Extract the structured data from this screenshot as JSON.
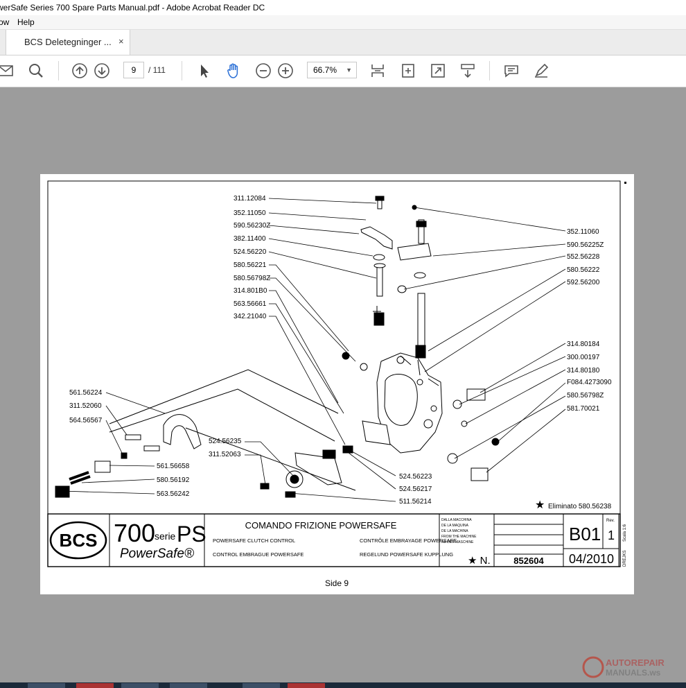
{
  "window": {
    "title": "werSafe Series 700 Spare Parts Manual.pdf - Adobe Acrobat Reader DC"
  },
  "menu": {
    "items": [
      "ow",
      "Help"
    ]
  },
  "tab": {
    "label": "BCS Deletegninger ...",
    "close": "×"
  },
  "toolbar": {
    "page_current": "9",
    "page_total": "/ 111",
    "zoom": "66.7%",
    "icons": [
      "mail-icon",
      "search-icon",
      "prev-page-icon",
      "next-page-icon",
      "select-tool-icon",
      "hand-tool-icon",
      "zoom-out-icon",
      "zoom-in-icon",
      "fit-page-icon",
      "rotate-icon",
      "fullscreen-icon",
      "scroll-mode-icon",
      "comment-icon",
      "highlight-icon"
    ]
  },
  "document": {
    "page_footer": "Side 9",
    "title_block": {
      "logo": "BCS",
      "series": "700",
      "series_small": "serie",
      "series_suffix": "PS",
      "brand": "PowerSafe®",
      "title": "COMANDO FRIZIONE POWERSAFE",
      "sub_en": "POWERSAFE CLUTCH CONTROL",
      "sub_fr": "CONTRÔLE EMBRAYAGE POWERSAFE",
      "sub_es": "CONTROL EMBRAGUE POWERSAFE",
      "sub_de": "REGELUND POWERSAFE KUPPLUNG",
      "from_machine": [
        "DALLA MACCHINA",
        "DE LA MAQUINA",
        "DE LA MACHINA",
        "FROM THE MACHINE",
        "AB DER MASCHINE"
      ],
      "star_n": "★ N.",
      "drawing_no": "852604",
      "code": "B01",
      "rev_label": "Rev.",
      "rev": "1",
      "date": "04/2010",
      "scale": "Scala 1:6",
      "drawn": "DREJKS",
      "eliminated": "Eliminato 580.56238"
    },
    "labels_left_top": [
      "311.12084",
      "352.11050",
      "590.56230Z",
      "382.11400",
      "524.56220",
      "580.56221",
      "580.56798Z",
      "314.801B0",
      "563.56661",
      "342.21040"
    ],
    "labels_right": [
      "352.11060",
      "590.56225Z",
      "552.56228",
      "580.56222",
      "592.56200",
      "314.80184",
      "300.00197",
      "314.80180",
      "F084.4273090",
      "580.56798Z",
      "581.70021"
    ],
    "labels_left_bottom": [
      "561.56224",
      "311.52060",
      "564.56567",
      "561.56658",
      "580.56192",
      "563.56242"
    ],
    "labels_center": [
      "524.56235",
      "311.52063",
      "524.56223",
      "524.56217",
      "511.56214"
    ]
  },
  "watermark": {
    "line1": "AUTOREPAIR",
    "line2": "MANUALS.ws"
  }
}
